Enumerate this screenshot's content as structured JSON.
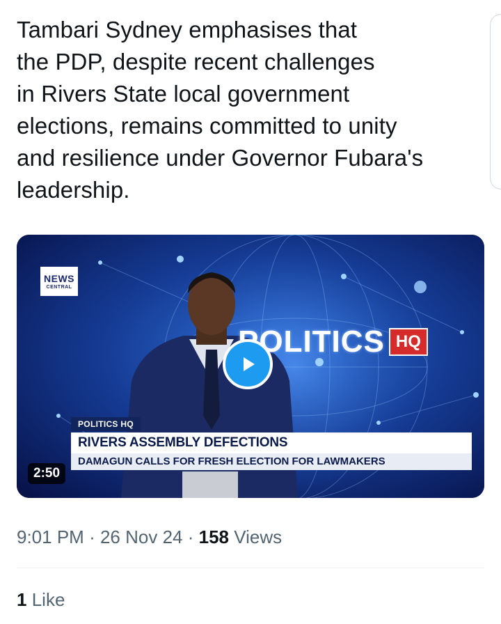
{
  "tweet": {
    "text_lines": [
      "Tambari Sydney emphasises that",
      "the PDP, despite recent challenges",
      "in Rivers State local government",
      "elections, remains committed to unity",
      "and resilience under Governor Fubara's",
      "leadership."
    ]
  },
  "media": {
    "logo_top": "NEWS",
    "logo_bottom": "CENTRAL",
    "brand_word": "POLITICS",
    "brand_badge": "HQ",
    "lower_third_tag": "POLITICS HQ",
    "headline": "RIVERS ASSEMBLY DEFECTIONS",
    "subheadline": "DAMAGUN CALLS FOR FRESH ELECTION FOR LAWMAKERS",
    "duration": "2:50",
    "play_icon": "play-icon"
  },
  "meta": {
    "time": "9:01 PM",
    "separator": "·",
    "date": "26 Nov 24",
    "views_count": "158",
    "views_label": "Views"
  },
  "engagement": {
    "likes_count": "1",
    "likes_label": "Like"
  },
  "colors": {
    "accent": "#1d9bf0",
    "text_primary": "#0f1419",
    "text_secondary": "#536471",
    "badge_red": "#d62b2b",
    "video_bg": "#0a1a4a"
  }
}
